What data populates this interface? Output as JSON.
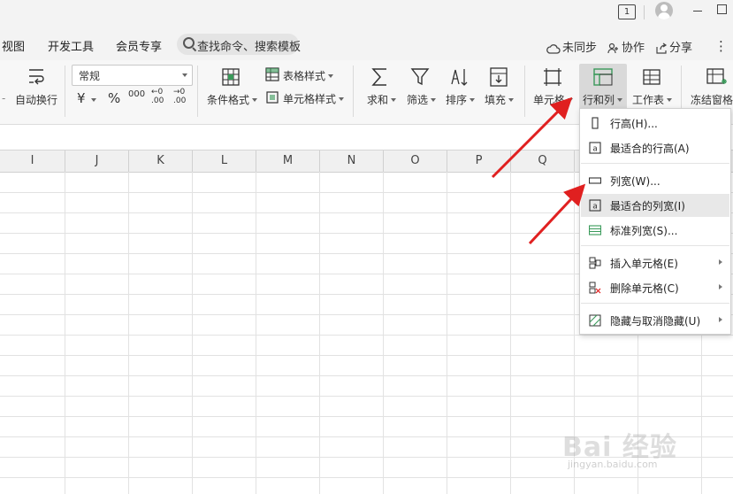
{
  "titlebar": {
    "page_indicator": "1"
  },
  "menubar": {
    "items": [
      "视图",
      "开发工具",
      "会员专享"
    ],
    "search_placeholder": "查找命令、搜索模板",
    "right": {
      "sync": "未同步",
      "collab": "协作",
      "share": "分享"
    }
  },
  "ribbon": {
    "wrap_text": "自动换行",
    "number_format": "常规",
    "currency": "¥",
    "percent": "%",
    "thousands": "000",
    "inc_decimal": ".00",
    "dec_decimal": ".00",
    "inc_decimal_top": "←0",
    "dec_decimal_top": "→0",
    "conditional_format": "条件格式",
    "table_style": "表格样式",
    "cell_style": "单元格样式",
    "sum": "求和",
    "filter": "筛选",
    "sort": "排序",
    "fill": "填充",
    "cell": "单元格",
    "row_col": "行和列",
    "worksheet": "工作表",
    "freeze": "冻结窗格"
  },
  "columns": [
    "I",
    "J",
    "K",
    "L",
    "M",
    "N",
    "O",
    "P",
    "Q"
  ],
  "dropdown": {
    "items": [
      {
        "label": "行高(H)...",
        "icon": "row-height-icon"
      },
      {
        "label": "最适合的行高(A)",
        "icon": "best-fit-row-icon"
      },
      {
        "label": "列宽(W)...",
        "icon": "column-width-icon"
      },
      {
        "label": "最适合的列宽(I)",
        "icon": "best-fit-column-icon"
      },
      {
        "label": "标准列宽(S)...",
        "icon": "standard-width-icon"
      },
      {
        "label": "插入单元格(E)",
        "icon": "insert-cell-icon"
      },
      {
        "label": "删除单元格(C)",
        "icon": "delete-cell-icon"
      },
      {
        "label": "隐藏与取消隐藏(U)",
        "icon": "hide-unhide-icon"
      }
    ]
  },
  "watermark": {
    "main": "Bai 经验",
    "sub": "jingyan.baidu.com"
  },
  "colors": {
    "arrow": "#e02020",
    "accent_green": "#3a9a5a",
    "hover": "#e8e8e8"
  }
}
